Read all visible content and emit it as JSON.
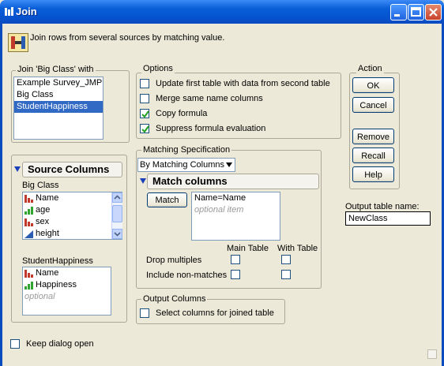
{
  "window": {
    "title": "Join"
  },
  "description": "Join rows from several sources by matching value.",
  "join_group": {
    "label": "Join 'Big Class' with",
    "items": [
      "Example Survey_JMP",
      "Big Class",
      "StudentHappiness"
    ],
    "selected_index": 2
  },
  "options": {
    "label": "Options",
    "items": [
      {
        "label": "Update first table with data from second table",
        "checked": false
      },
      {
        "label": "Merge same name columns",
        "checked": false
      },
      {
        "label": "Copy formula",
        "checked": true
      },
      {
        "label": "Suppress formula evaluation",
        "checked": true
      }
    ]
  },
  "action": {
    "label": "Action",
    "ok": "OK",
    "cancel": "Cancel",
    "remove": "Remove",
    "recall": "Recall",
    "help": "Help"
  },
  "source_columns": {
    "title": "Source Columns",
    "table1_label": "Big Class",
    "table1_columns": [
      {
        "name": "Name",
        "icon": "nominal-icon"
      },
      {
        "name": "age",
        "icon": "ordinal-icon"
      },
      {
        "name": "sex",
        "icon": "nominal-icon"
      },
      {
        "name": "height",
        "icon": "continuous-icon"
      }
    ],
    "table2_label": "StudentHappiness",
    "table2_columns": [
      {
        "name": "Name",
        "icon": "nominal-icon"
      },
      {
        "name": "Happiness",
        "icon": "ordinal-icon"
      }
    ],
    "optional_text": "optional"
  },
  "matching": {
    "label": "Matching Specification",
    "method": "By Matching Columns",
    "match_title": "Match columns",
    "match_button": "Match",
    "match_items": [
      "Name=Name"
    ],
    "optional_item": "optional item",
    "main_table_header": "Main Table",
    "with_table_header": "With Table",
    "drop_multiples": "Drop multiples",
    "include_non_matches": "Include non-matches"
  },
  "output_table": {
    "label": "Output table name:",
    "value": "NewClass"
  },
  "output_columns": {
    "label": "Output Columns",
    "select_label": "Select columns for joined table"
  },
  "keep_dialog_open": "Keep dialog open",
  "colors": {
    "titlebar": "#0553d0",
    "dialog_bg": "#ece9d8",
    "selection": "#316ac5",
    "check": "#21a121"
  }
}
